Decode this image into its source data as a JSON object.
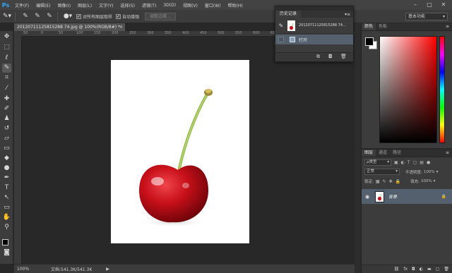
{
  "app": {
    "logo": "Ps"
  },
  "menubar": {
    "items": [
      "文件(F)",
      "编辑(E)",
      "图像(I)",
      "图层(L)",
      "文字(Y)",
      "选择(S)",
      "滤镜(T)",
      "3D(D)",
      "视图(V)",
      "窗口(W)",
      "帮助(H)"
    ],
    "window_controls": [
      "–",
      "□",
      "✕"
    ]
  },
  "options": {
    "sample_all_layers_label": "对所有图层取样",
    "sample_all_layers_checked": true,
    "auto_enhance_label": "自动增强",
    "auto_enhance_checked": true,
    "refine_edge_label": "调整边缘...",
    "workspace": "基本功能"
  },
  "document": {
    "tab_title": "20120711125815288 74.jpg @ 100%(RGB/8#) *",
    "tab_close": "×",
    "ruler_ticks": [
      "50",
      "0",
      "50",
      "100",
      "150",
      "200",
      "250",
      "300",
      "350",
      "400",
      "450",
      "500",
      "550",
      "600",
      "650",
      "700",
      "750",
      "800",
      "850"
    ]
  },
  "status": {
    "zoom": "100%",
    "doc_size": "文档:541.3K/541.3K",
    "arrow": "▶"
  },
  "history": {
    "tab_label": "历史记录",
    "menu_icon": "▾≡",
    "snapshot_name": "20120711125815288 74...",
    "states": [
      {
        "label": "打开"
      }
    ],
    "footer_icons": [
      "new-document-from-state-icon",
      "camera-icon",
      "trash-icon"
    ]
  },
  "color_panel": {
    "tabs": [
      "颜色",
      "色板"
    ],
    "active_tab": 0,
    "foreground": "#000000",
    "background": "#ffffff"
  },
  "layers": {
    "tabs": [
      "图层",
      "通道",
      "路径"
    ],
    "active_tab": 0,
    "filter_kind": "ρ类型",
    "blend_mode": "正常",
    "opacity_label": "不透明度:",
    "opacity_value": "100%",
    "lock_label": "锁定:",
    "fill_label": "填充:",
    "fill_value": "100%",
    "items": [
      {
        "name": "背景",
        "visible": true,
        "locked": true
      }
    ],
    "footer_icons": [
      "link-icon",
      "fx-icon",
      "mask-icon",
      "adjustment-icon",
      "folder-icon",
      "new-layer-icon",
      "trash-icon"
    ]
  },
  "colors": {
    "accent": "#31a8ff",
    "selection": "#55606e",
    "cherry_red": "#c8101a",
    "stem_green": "#8fb84a"
  }
}
